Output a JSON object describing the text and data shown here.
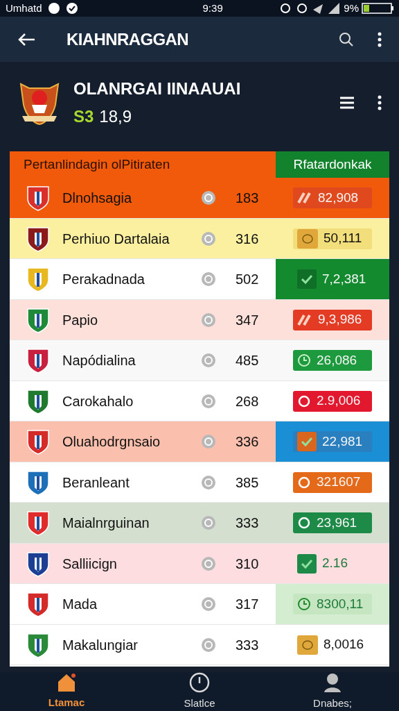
{
  "status_bar": {
    "carrier": "Umhatd",
    "time": "9:39",
    "battery": "9%"
  },
  "app_bar": {
    "title": "KIAHNRAGGAN"
  },
  "profile": {
    "name": "OLANRGAI IINAAUAI",
    "currency": "S3",
    "amount": "18,9"
  },
  "table": {
    "columns": [
      "Pertanlindagin olPitiraten",
      "Rfatardonkak"
    ],
    "rows": [
      {
        "name": "Dlnohsagia",
        "points": "183",
        "color": "#f15a0a",
        "crest": {
          "color": "#d9302b"
        },
        "value_cell": {
          "color": "#f15a0a"
        },
        "badge": {
          "kind": "arrow",
          "color": "#e0491e"
        },
        "value": "82,908"
      },
      {
        "name": "Perhiuo Dartalaia",
        "points": "316",
        "color": "#fbf0a0",
        "crest": {
          "color": "#8b1a1a"
        },
        "value_cell": {
          "color": "#fbf0a0"
        },
        "badge": {
          "kind": "coin",
          "color": "#f3de7c"
        },
        "value": "50,111"
      },
      {
        "name": "Perakadnada",
        "points": "502",
        "color": "#ffffff",
        "crest": {
          "color": "#e8b820"
        },
        "value_cell": {
          "color": "#138a2d"
        },
        "badge": {
          "kind": "check",
          "color": "#138a2d"
        },
        "value": "7,2,381"
      },
      {
        "name": "Papio",
        "points": "347",
        "color": "#fde0da",
        "crest": {
          "color": "#1f8a3a"
        },
        "value_cell": {
          "color": "#fde0da"
        },
        "badge": {
          "kind": "arrow",
          "color": "#e43b25"
        },
        "value": "9,3,986"
      },
      {
        "name": "Napódialina",
        "points": "485",
        "color": "#f8f8f8",
        "crest": {
          "color": "#c8203f"
        },
        "value_cell": {
          "color": "#f8f8f8"
        },
        "badge": {
          "kind": "clock",
          "color": "#1d9a3d"
        },
        "value": "26,086"
      },
      {
        "name": "Carokahalo",
        "points": "268",
        "color": "#ffffff",
        "crest": {
          "color": "#1f7a30"
        },
        "value_cell": {
          "color": "#ffffff"
        },
        "badge": {
          "kind": "circle",
          "color": "#e2182e"
        },
        "value": "2.9,006"
      },
      {
        "name": "Oluahodrgnsaio",
        "points": "336",
        "color": "#fbbfad",
        "crest": {
          "color": "#d42a2a"
        },
        "value_cell": {
          "color": "#1a8fd6"
        },
        "badge": {
          "kind": "check",
          "color": "#2a7fbf"
        },
        "value": "22,981"
      },
      {
        "name": "Beranleant",
        "points": "385",
        "color": "#ffffff",
        "crest": {
          "color": "#1d6fb8"
        },
        "value_cell": {
          "color": "#ffffff"
        },
        "badge": {
          "kind": "circle",
          "color": "#e46a1a"
        },
        "value": "321607"
      },
      {
        "name": "Maialnrguinan",
        "points": "333",
        "color": "#d5dfcf",
        "crest": {
          "color": "#e02b2b"
        },
        "value_cell": {
          "color": "#d5dfcf"
        },
        "badge": {
          "kind": "circle",
          "color": "#1e8a48"
        },
        "value": "23,961"
      },
      {
        "name": "Salliicign",
        "points": "310",
        "color": "#fddde0",
        "crest": {
          "color": "#1c3f94"
        },
        "value_cell": {
          "color": "#fddde0"
        },
        "badge": {
          "kind": "check",
          "color": "#fddde0"
        },
        "value": "2.16"
      },
      {
        "name": "Mada",
        "points": "317",
        "color": "#ffffff",
        "crest": {
          "color": "#d42a2a"
        },
        "value_cell": {
          "color": "#d4ecd0"
        },
        "badge": {
          "kind": "clock",
          "color": "#c6e6c2"
        },
        "value": "8300,11"
      },
      {
        "name": "Makalungiar",
        "points": "333",
        "color": "#ffffff",
        "crest": {
          "color": "#2a8a3a"
        },
        "value_cell": {
          "color": "#ffffff"
        },
        "badge": {
          "kind": "coin",
          "color": "#ffffff"
        },
        "value": "8,0016"
      }
    ]
  },
  "bottom_nav": [
    {
      "label": "Ltamac",
      "selected": true,
      "kind": "home"
    },
    {
      "label": "Slatlce",
      "selected": false,
      "kind": "power"
    },
    {
      "label": "Dnabes;",
      "selected": false,
      "kind": "person"
    }
  ]
}
